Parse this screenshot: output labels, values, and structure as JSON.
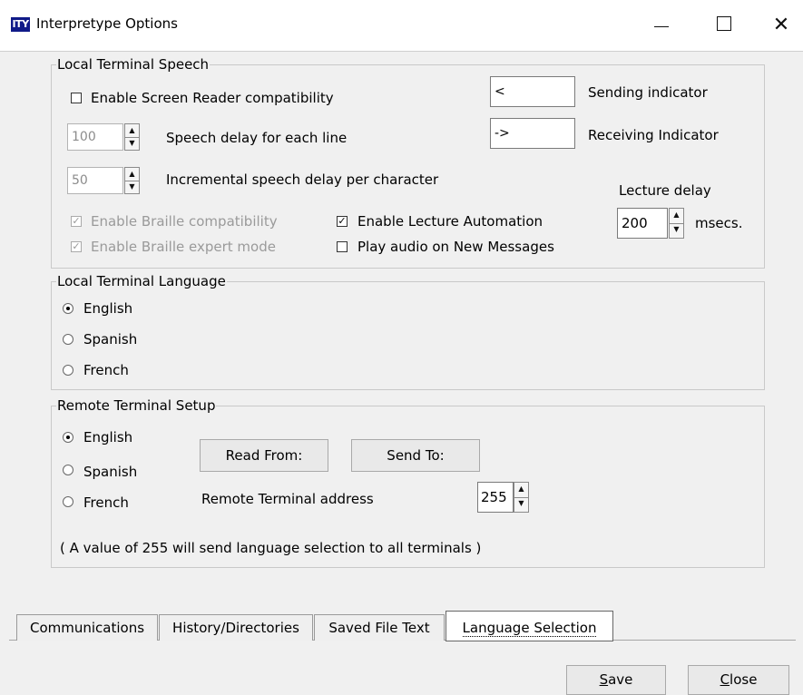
{
  "window": {
    "app_icon_text": "ITY",
    "title": "Interpretype Options",
    "controls": {
      "minimize": "minimize",
      "maximize": "maximize",
      "close": "close"
    }
  },
  "local_speech": {
    "group_label": "Local Terminal Speech",
    "screen_reader": {
      "label": "Enable Screen Reader compatibility",
      "checked": false
    },
    "speech_delay": {
      "value": "100",
      "label": "Speech delay for each line"
    },
    "incremental_delay": {
      "value": "50",
      "label": "Incremental speech delay per character"
    },
    "braille": {
      "label": "Enable Braille compatibility",
      "checked": true,
      "disabled": true
    },
    "braille_expert": {
      "label": "Enable Braille expert mode",
      "checked": true,
      "disabled": true
    },
    "lecture_automation": {
      "label": "Enable Lecture Automation",
      "checked": true
    },
    "play_audio": {
      "label": "Play audio on New Messages",
      "checked": false
    },
    "sending_indicator": {
      "value": "<",
      "label": "Sending indicator"
    },
    "receiving_indicator": {
      "value": "->",
      "label": "Receiving Indicator"
    },
    "lecture_delay": {
      "label": "Lecture delay",
      "value": "200",
      "unit": "msecs."
    }
  },
  "local_language": {
    "group_label": "Local Terminal Language",
    "options": [
      "English",
      "Spanish",
      "French"
    ],
    "selected": "English"
  },
  "remote_setup": {
    "group_label": "Remote Terminal Setup",
    "options": [
      "English",
      "Spanish",
      "French"
    ],
    "selected": "English",
    "read_from_button": "Read From:",
    "send_to_button": "Send To:",
    "address_label": "Remote Terminal address",
    "address_value": "255",
    "note": "( A value of 255 will send language selection to all terminals )"
  },
  "tabs": [
    "Communications",
    "History/Directories",
    "Saved File Text",
    "Language Selection"
  ],
  "active_tab": "Language Selection",
  "footer": {
    "save_first": "S",
    "save_rest": "ave",
    "close_first": "C",
    "close_rest": "lose"
  },
  "colors": {
    "app_icon_bg": "#101a88",
    "window_bg": "#f0f0f0",
    "disabled_text": "#9a9a9a"
  }
}
